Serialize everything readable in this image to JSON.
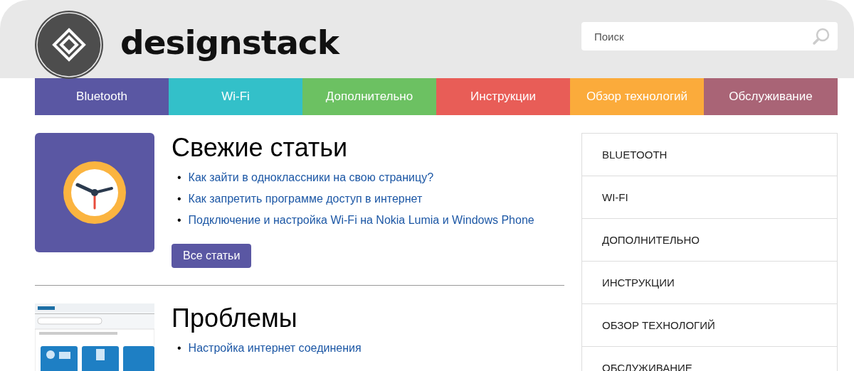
{
  "header": {
    "logo_text": "designstack",
    "search": {
      "placeholder": "Поиск"
    }
  },
  "nav": [
    {
      "label": "Bluetooth",
      "color": "#5a57a3"
    },
    {
      "label": "Wi-Fi",
      "color": "#33c0c9"
    },
    {
      "label": "Дополнительно",
      "color": "#6cc162"
    },
    {
      "label": "Инструкции",
      "color": "#e85d57"
    },
    {
      "label": "Обзор технологий",
      "color": "#fbab3b"
    },
    {
      "label": "Обслуживание",
      "color": "#a96476"
    }
  ],
  "sections": [
    {
      "kind": "clock",
      "title": "Свежие статьи",
      "links": [
        {
          "marker": "•",
          "text": "Как зайти в одноклассники на свою страницу?"
        },
        {
          "marker": "•",
          "text": "Как запретить программе доступ в интернет"
        },
        {
          "marker": "•",
          "text": "Подключение и настройка Wi-Fi на Nokia Lumia и Windows Phone"
        }
      ],
      "button": "Все статьи"
    },
    {
      "kind": "picture",
      "title": "Проблемы",
      "links": [
        {
          "marker": "•",
          "text": "Настройка интернет соединения"
        }
      ]
    }
  ],
  "sidebar": [
    "BLUETOOTH",
    "WI-FI",
    "ДОПОЛНИТЕЛЬНО",
    "ИНСТРУКЦИИ",
    "ОБЗОР ТЕХНОЛОГИЙ",
    "ОБСЛУЖИВАНИЕ"
  ]
}
